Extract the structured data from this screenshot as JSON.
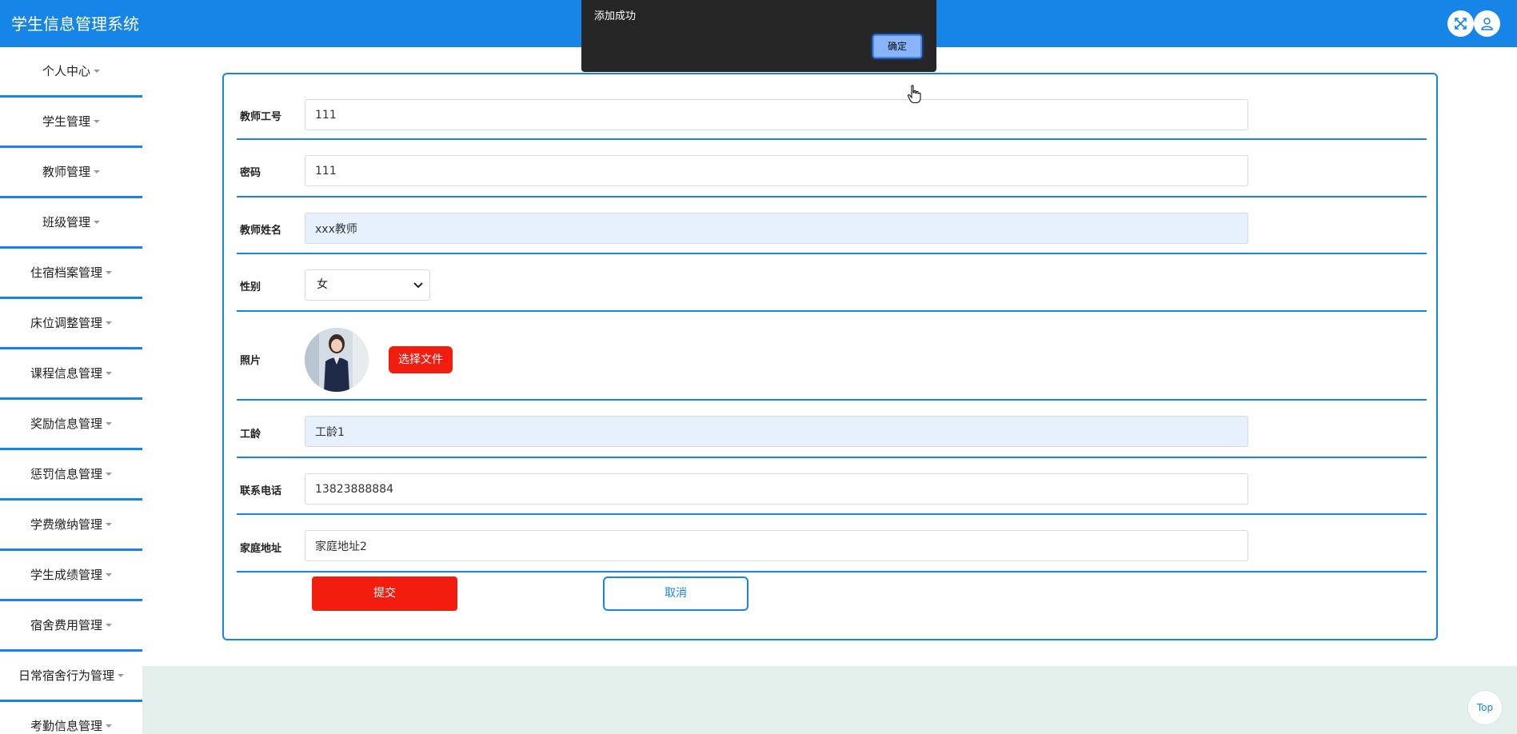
{
  "app": {
    "title": "学生信息管理系统"
  },
  "header_icons": [
    "fullscreen-icon",
    "user-icon"
  ],
  "sidebar": {
    "items": [
      {
        "label": "个人中心"
      },
      {
        "label": "学生管理"
      },
      {
        "label": "教师管理"
      },
      {
        "label": "班级管理"
      },
      {
        "label": "住宿档案管理"
      },
      {
        "label": "床位调整管理"
      },
      {
        "label": "课程信息管理"
      },
      {
        "label": "奖励信息管理"
      },
      {
        "label": "惩罚信息管理"
      },
      {
        "label": "学费缴纳管理"
      },
      {
        "label": "学生成绩管理"
      },
      {
        "label": "宿舍费用管理"
      },
      {
        "label": "日常宿舍行为管理"
      },
      {
        "label": "考勤信息管理"
      }
    ]
  },
  "form": {
    "teacher_id": {
      "label": "教师工号",
      "value": "111"
    },
    "password": {
      "label": "密码",
      "value": "111"
    },
    "teacher_name": {
      "label": "教师姓名",
      "value": "xxx教师"
    },
    "gender": {
      "label": "性别",
      "value": "女"
    },
    "photo": {
      "label": "照片",
      "button": "选择文件"
    },
    "seniority": {
      "label": "工龄",
      "value": "工龄1"
    },
    "phone": {
      "label": "联系电话",
      "value": "13823888884"
    },
    "address": {
      "label": "家庭地址",
      "value": "家庭地址2"
    },
    "submit": "提交",
    "cancel": "取消"
  },
  "dialog": {
    "message": "添加成功",
    "ok": "确定"
  },
  "back_to_top": "Top",
  "colors": {
    "primary": "#1785e8",
    "danger": "#f21c0f",
    "dialog_bg": "#262626",
    "input_filled": "#e7f0fd",
    "content_bg": "#e3f0ec"
  }
}
